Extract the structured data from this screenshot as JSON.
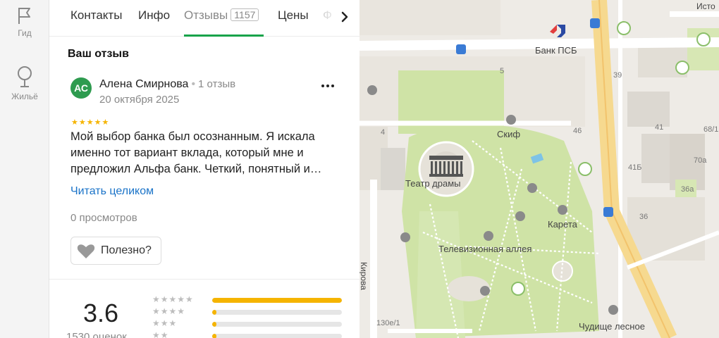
{
  "rail": {
    "guide_label": "Гид",
    "housing_label": "Жильё"
  },
  "tabs": {
    "contacts": "Контакты",
    "info": "Инфо",
    "reviews": "Отзывы",
    "reviews_count": "1157",
    "prices": "Цены",
    "next_partial": "Ф"
  },
  "review_section": {
    "title": "Ваш отзыв",
    "avatar_initials": "АС",
    "author_name": "Алена Смирнова",
    "author_reviews": "1 отзыв",
    "date": "20 октября 2025",
    "stars": "★★★★★",
    "text": "Мой выбор банка был осознанным. Я искала именно тот вариант вклада, который мне и предложил Альфа банк. Четкий, понятный и…",
    "read_more": "Читать целиком",
    "views": "0 просмотров",
    "useful_label": "Полезно?"
  },
  "rating_summary": {
    "value": "3.6",
    "count_label": "1530 оценок",
    "distribution": [
      {
        "stars": "★★★★★",
        "fraction": 1.0
      },
      {
        "stars": "★★★★",
        "fraction": 0.03
      },
      {
        "stars": "★★★",
        "fraction": 0.03
      },
      {
        "stars": "★★",
        "fraction": 0.03
      }
    ]
  },
  "map": {
    "labels": {
      "bank": "Банк ПСБ",
      "theatre": "Театр драмы",
      "skif": "Скиф",
      "tv_alley": "Телевизионная аллея",
      "kareta": "Карета",
      "chudishe": "Чудище лесное",
      "kirova": "Кирова",
      "isto": "Исто"
    },
    "numbers": [
      "39",
      "5",
      "46",
      "41",
      "68/1",
      "4",
      "41Б",
      "70а",
      "36а",
      "36",
      "130е/1"
    ]
  },
  "colors": {
    "accent_green": "#18a34a",
    "avatar_green": "#2e9b4f",
    "star_yellow": "#f5b400",
    "link_blue": "#1a73c8"
  }
}
